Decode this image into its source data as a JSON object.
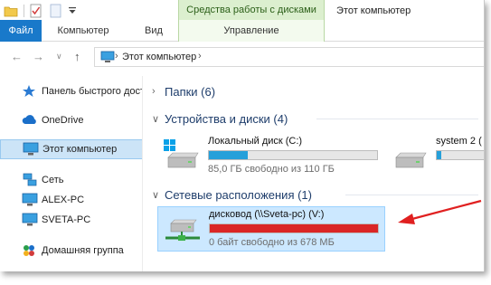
{
  "window": {
    "title": "Этот компьютер",
    "context_group": "Средства работы с дисками"
  },
  "ribbon": {
    "tabs": [
      {
        "label": "Файл"
      },
      {
        "label": "Компьютер"
      },
      {
        "label": "Вид"
      },
      {
        "label": "Управление"
      }
    ]
  },
  "address": {
    "path": "Этот компьютер",
    "separator": "›"
  },
  "sidebar": {
    "items": [
      {
        "label": "Панель быстрого доступа",
        "icon": "star-icon",
        "selected": false
      },
      {
        "label": "OneDrive",
        "icon": "cloud-icon",
        "selected": false
      },
      {
        "label": "Этот компьютер",
        "icon": "computer-icon",
        "selected": true
      },
      {
        "label": "Сеть",
        "icon": "network-icon",
        "selected": false
      },
      {
        "label": "ALEX-PC",
        "icon": "computer-icon",
        "selected": false
      },
      {
        "label": "SVETA-PC",
        "icon": "computer-icon",
        "selected": false
      },
      {
        "label": "Домашняя группа",
        "icon": "homegroup-icon",
        "selected": false
      }
    ]
  },
  "main": {
    "groups": {
      "folders": "Папки (6)",
      "devices": "Устройства и диски (4)",
      "network": "Сетевые расположения (1)"
    },
    "drives": [
      {
        "name": "Локальный диск (C:)",
        "free": "85,0 ГБ свободно из 110 ГБ",
        "used_fraction": 0.23
      },
      {
        "name": "system 2 (",
        "free": "",
        "used_fraction": 0.05
      }
    ],
    "network_drive": {
      "name": "дисковод (\\\\Sveta-pc) (V:)",
      "free": "0 байт свободно из 678 МБ",
      "used_fraction": 1.0
    }
  },
  "colors": {
    "accent": "#1979ca",
    "drive_fill": "#26a0da",
    "full_drive_fill": "#da2626",
    "context_tab": "#dcefcf",
    "selection": "#cce8ff",
    "annotation_arrow": "#e02020"
  }
}
